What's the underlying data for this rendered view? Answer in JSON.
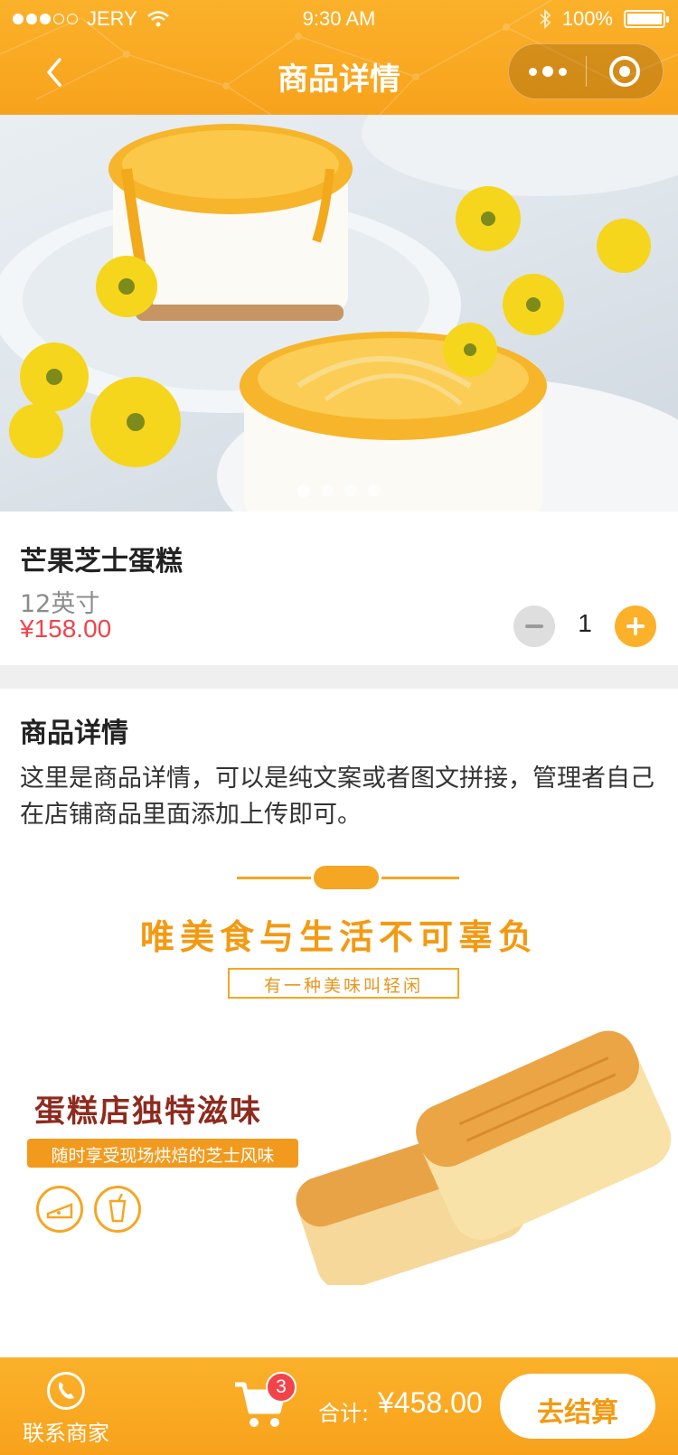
{
  "status_bar": {
    "carrier": "JERY",
    "time": "9:30 AM",
    "battery": "100%",
    "battery_level": 1.0,
    "signal_bars": 3,
    "signal_total": 5
  },
  "nav": {
    "title": "商品详情",
    "back_icon": "chevron-left-icon",
    "more_icon": "more-dots-icon",
    "close_icon": "record-circle-icon"
  },
  "gallery": {
    "slide_count": 4,
    "active_index": 0
  },
  "product": {
    "name": "芒果芝士蛋糕",
    "spec": "12英寸",
    "price": "¥158.00",
    "quantity": "1"
  },
  "detail": {
    "title": "商品详情",
    "text": "这里是商品详情，可以是纯文案或者图文拼接，管理者自己在店铺商品里面添加上传即可。"
  },
  "banner": {
    "headline": "唯美食与生活不可辜负",
    "subline": "有一种美味叫轻闲"
  },
  "promo": {
    "headline": "蛋糕店独特滋味",
    "tagline": "随时享受现场烘焙的芝士风味",
    "icons": [
      "cheese-icon",
      "drink-cup-icon"
    ]
  },
  "bottom_bar": {
    "contact_label": "联系商家",
    "cart_count": "3",
    "total_label": "合计:",
    "total_value": "¥458.00",
    "checkout_label": "去结算"
  },
  "colors": {
    "brand": "#f8a21c",
    "price": "#f2434b",
    "promo_brown": "#8e2a1e"
  }
}
